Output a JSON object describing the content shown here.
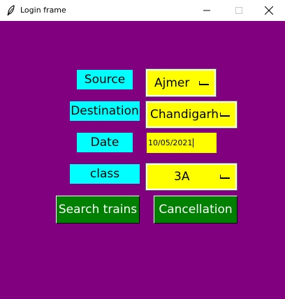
{
  "window": {
    "title": "Login frame",
    "background": "#800080"
  },
  "labels": {
    "source": "Source",
    "destination": "Destination",
    "date": "Date",
    "class": "class"
  },
  "fields": {
    "source_value": "Ajmer",
    "destination_value": "Chandigarh",
    "date_value": "10/05/2021",
    "class_value": "3A"
  },
  "buttons": {
    "search": "Search trains",
    "cancel": "Cancellation"
  },
  "colors": {
    "label_bg": "#00ffff",
    "field_bg": "#ffff00",
    "button_bg": "#008000"
  }
}
